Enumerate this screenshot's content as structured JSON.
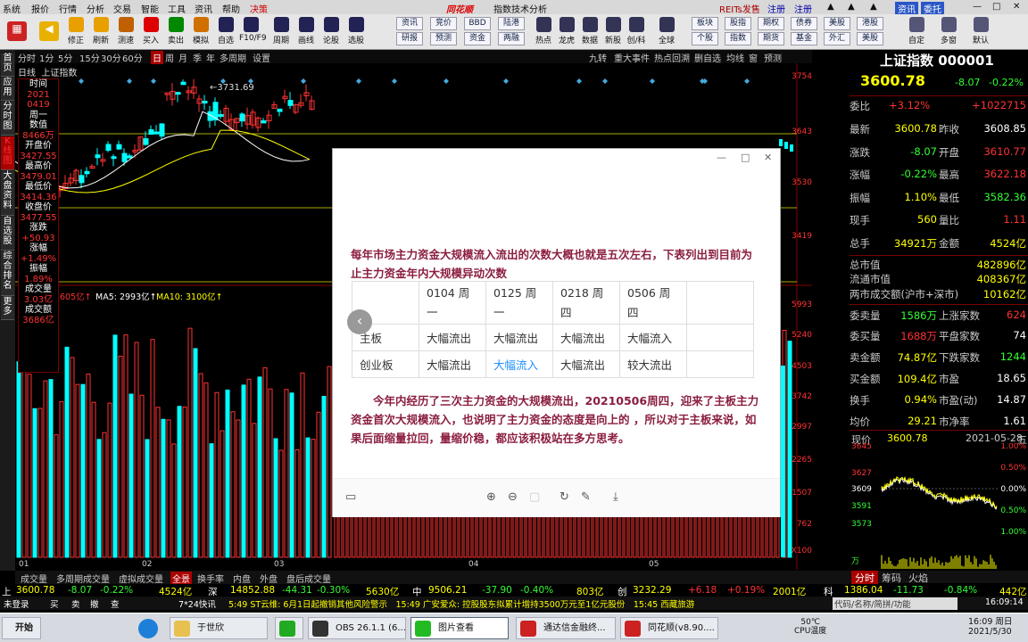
{
  "app": {
    "title": "同花顺 - 指数技术分析",
    "brand": "同花顺",
    "subtitle": "指数技术分析"
  },
  "menu": [
    "系统",
    "报价",
    "行情",
    "分析",
    "交易",
    "智能",
    "工具",
    "资讯",
    "帮助",
    "决策"
  ],
  "menu_right": {
    "reits": "REITs发售",
    "login": "注册",
    "register": "注册"
  },
  "menu_right_labels": [
    "资讯",
    "委托"
  ],
  "toolbar": {
    "left": [
      {
        "label": "修正",
        "icon": "up-down-arrows-icon",
        "color": "#e8a000"
      },
      {
        "label": "刷新",
        "icon": "refresh-icon",
        "color": "#e8a000"
      },
      {
        "label": "测速",
        "icon": "speedometer-icon",
        "color": "#c06000"
      },
      {
        "label": "买入",
        "icon": "buy-icon",
        "color": "#d00"
      },
      {
        "label": "卖出",
        "icon": "sell-icon",
        "color": "#080"
      },
      {
        "label": "模拟",
        "icon": "hammer-icon",
        "color": "#d07000"
      },
      {
        "label": "自选",
        "icon": "star-icon",
        "color": "#225"
      },
      {
        "label": "F10/F9",
        "icon": "f10-icon",
        "color": "#225"
      },
      {
        "label": "周期",
        "icon": "period-icon",
        "color": "#225"
      },
      {
        "label": "画线",
        "icon": "pen-icon",
        "color": "#225"
      },
      {
        "label": "论股",
        "icon": "forum-icon",
        "color": "#225"
      },
      {
        "label": "选股",
        "icon": "select-stock-icon",
        "color": "#225"
      }
    ],
    "grid": [
      [
        "资讯",
        "竞价",
        "BBD",
        "陆港"
      ],
      [
        "研报",
        "预测",
        "资金",
        "两融"
      ]
    ],
    "mid": [
      {
        "label": "热点",
        "icon": "hotspot-icon"
      },
      {
        "label": "龙虎",
        "icon": "dragon-tiger-icon"
      },
      {
        "label": "数据",
        "icon": "data-icon"
      },
      {
        "label": "新股",
        "icon": "new-stock-icon"
      },
      {
        "label": "创/科",
        "icon": "chuang-ke-icon"
      },
      {
        "label": "全球",
        "icon": "globe-icon"
      }
    ],
    "grid2": [
      [
        "板块",
        "股指",
        "期权",
        "债券",
        "美股",
        "港股"
      ],
      [
        "个股",
        "指数",
        "期货",
        "基金",
        "外汇",
        "美股"
      ]
    ],
    "right": [
      {
        "label": "自定",
        "icon": "custom-icon"
      },
      {
        "label": "多窗",
        "icon": "multi-window-icon"
      },
      {
        "label": "默认",
        "icon": "home-icon"
      }
    ]
  },
  "lefttabs": [
    "首页",
    "应用",
    "分时图",
    "K线图",
    "大盘资料",
    "自选股",
    "综合排名",
    "更多"
  ],
  "periods": [
    "分时",
    "1分",
    "5分",
    "15分",
    "30分",
    "60分",
    "日",
    "周",
    "月",
    "季",
    "年",
    "多周期",
    "设置"
  ],
  "period_active": "日",
  "period_right": [
    "九转",
    "重大事件",
    "热点回溯",
    "删自选",
    "均线",
    "窗",
    "预测"
  ],
  "chart_header": {
    "mode": "日线",
    "name": "上证指数"
  },
  "kline": {
    "high_label": "3731.69",
    "price_axis": [
      "3754",
      "3643",
      "3530",
      "3419"
    ],
    "vol_axis": [
      "5993",
      "5240",
      "4503",
      "3742",
      "2997",
      "2265",
      "1507",
      "762",
      "X100"
    ],
    "vol_header": {
      "vol": "605亿",
      "ma5": "MA5: 2993亿",
      "ma10": "MA10: 3100亿"
    },
    "months": [
      "01",
      "02",
      "03",
      "04",
      "05"
    ]
  },
  "info": [
    {
      "k": "时间",
      "v": "2021"
    },
    {
      "k": "",
      "v": "0419"
    },
    {
      "k": "周一",
      "v": ""
    },
    {
      "k": "数值",
      "v": "8466万"
    },
    {
      "k": "开盘价",
      "v": "3427.55"
    },
    {
      "k": "最高价",
      "v": "3479.01"
    },
    {
      "k": "最低价",
      "v": "3414.36"
    },
    {
      "k": "收盘价",
      "v": "3477.55"
    },
    {
      "k": "涨跌",
      "v": "+50.93"
    },
    {
      "k": "涨幅",
      "v": "+1.49%"
    },
    {
      "k": "振幅",
      "v": "1.89%"
    },
    {
      "k": "成交量",
      "v": "3.03亿"
    },
    {
      "k": "成交额",
      "v": "3686亿"
    }
  ],
  "popup": {
    "para1": "每年市场主力资金大规模流入流出的次数大概也就是五次左右，下表列出到目前为止主力资金年内大规模异动次数",
    "headers": [
      "",
      "0104 周一",
      "0125 周一",
      "0218 周四",
      "0506 周四",
      ""
    ],
    "rows": [
      [
        "主板",
        "大幅流出",
        "大幅流出",
        "大幅流出",
        "大幅流入",
        ""
      ],
      [
        "创业板",
        "大幅流出",
        "大幅流入",
        "大幅流出",
        "较大流出",
        ""
      ]
    ],
    "highlight": "大幅流入",
    "para2": "今年内经历了三次主力资金的大规模流出，20210506周四，迎来了主板主力资金首次大规模流入，也说明了主力资金的态度是向上的 ，所以对于主板来说，如果后面缩量拉回，量缩价稳，都应该积极站在多方思考。"
  },
  "quote": {
    "name": "上证指数 000001",
    "price": "3600.78",
    "change": "-8.07",
    "pct": "-0.22%",
    "weibi": {
      "label": "委比",
      "pct": "+3.12%",
      "val": "+1022715"
    },
    "rows": [
      [
        "最新",
        "3600.78",
        "昨收",
        "3608.85"
      ],
      [
        "涨跌",
        "-8.07",
        "开盘",
        "3610.77"
      ],
      [
        "涨幅",
        "-0.22%",
        "最高",
        "3622.18"
      ],
      [
        "振幅",
        "1.10%",
        "最低",
        "3582.36"
      ],
      [
        "现手",
        "560",
        "量比",
        "1.11"
      ],
      [
        "总手",
        "34921万",
        "金额",
        "4524亿"
      ]
    ],
    "mcap": [
      [
        "总市值",
        "482896亿"
      ],
      [
        "流通市值",
        "408367亿"
      ],
      [
        "两市成交额(沪市+深市)",
        "10162亿"
      ]
    ],
    "rows2": [
      [
        "委卖量",
        "1586万",
        "上涨家数",
        "624"
      ],
      [
        "委买量",
        "1688万",
        "平盘家数",
        "74"
      ],
      [
        "卖金额",
        "74.87亿",
        "下跌家数",
        "1244"
      ],
      [
        "买金额",
        "109.4亿",
        "市盈",
        "18.65"
      ],
      [
        "换手",
        "0.94%",
        "市盈(动)",
        "14.87"
      ],
      [
        "均价",
        "29.21",
        "市净率",
        "1.61"
      ]
    ],
    "mini": {
      "label": "现价",
      "price": "3600.78",
      "date": "2021-05-28",
      "day": "五",
      "yl": [
        "3645",
        "3627",
        "3609",
        "3591",
        "3573",
        "万"
      ],
      "yr": [
        "1.00%",
        "0.50%",
        "0.00%",
        "0.50%",
        "1.00%"
      ]
    },
    "tabs": [
      "分时",
      "筹码",
      "火焰"
    ]
  },
  "bottomtabs": [
    "成交量",
    "多周期成交量",
    "虚拟成交量",
    "全景",
    "换手率",
    "内盘",
    "外盘",
    "盘后成交量"
  ],
  "ticker": [
    "上",
    "3600.78",
    "-8.07",
    "-0.22%",
    "4524亿",
    "深",
    "14852.88",
    "-44.31",
    "-0.30%",
    "5630亿",
    "中",
    "9506.21",
    "-37.90",
    "-0.40%",
    "803亿",
    "创",
    "3232.29",
    "+6.18",
    "+0.19%",
    "2001亿",
    "科",
    "1386.04",
    "-11.73",
    "-0.84%",
    "442亿"
  ],
  "status": {
    "left": "未登录",
    "cells": [
      "买",
      "卖",
      "撤",
      "查",
      "□"
    ],
    "info": "7*24快讯",
    "news": "5:49 ST云维: 6月1日起撤销其他风险警示　15:49 广安爱众: 控股股东拟累计增持3500万元至1亿元股份　15:45 西藏旅游",
    "code_hint": "代码/名称/简拼/功能",
    "time": "16:09:14"
  },
  "taskbar": {
    "start": "开始",
    "items": [
      {
        "label": "于世欣",
        "color": "#e8c050"
      },
      {
        "label": "",
        "color": "#2a2"
      },
      {
        "label": "OBS 26.1.1 (6...",
        "color": "#333"
      },
      {
        "label": "图片查看",
        "color": "#2b2"
      },
      {
        "label": "通达信金融终...",
        "color": "#c22"
      },
      {
        "label": "同花顺(v8.90....",
        "color": "#c22"
      }
    ],
    "cpu": "50℃",
    "cpu_label": "CPU温度",
    "clock_time": "16:09",
    "clock_day": "周日",
    "clock_date": "2021/5/30"
  }
}
